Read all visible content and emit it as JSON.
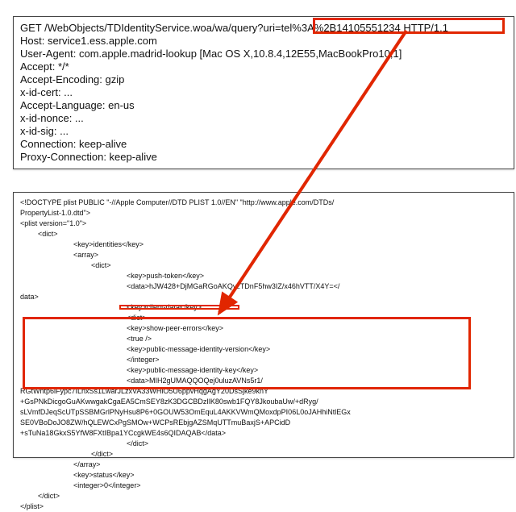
{
  "http": {
    "method_line": "GET /WebObjects/TDIdentityService.woa/wa/query?uri=tel%3A%2B14105551234 HTTP/1.1",
    "host": "Host: service1.ess.apple.com",
    "ua": "User-Agent: com.apple.madrid-lookup [Mac OS X,10.8.4,12E55,MacBookPro10,1]",
    "accept": "Accept: */*",
    "enc": "Accept-Encoding: gzip",
    "cert": "x-id-cert: ...",
    "lang": "Accept-Language: en-us",
    "nonce": "x-id-nonce: ...",
    "sig": "x-id-sig: ...",
    "conn": "Connection: keep-alive",
    "proxy": "Proxy-Connection: keep-alive"
  },
  "plist": {
    "doctype1": "<!DOCTYPE plist PUBLIC \"-//Apple Computer//DTD PLIST 1.0//EN\" \"http://www.apple.com/DTDs/",
    "doctype2": "PropertyList-1.0.dtd\">",
    "plist_open": "<plist version=\"1.0\">",
    "dict_open": "<dict>",
    "key_identities": "<key>identities</key>",
    "array_open": "<array>",
    "dict2_open": "<dict>",
    "key_push": "<key>push-token</key>",
    "data_push1": "<data>hJW428+DjMGaRGoAKQvzTDnF5hw3IZ/x46hVTT/X4Y=</",
    "data_push2": "data>",
    "key_client": "<key>client-data</key>",
    "dict3_open": "<dict>",
    "key_show": "<key>show-peer-errors</key>",
    "true": "<true />",
    "key_pmiv": "<key>public-message-identity-version</key>",
    "wbr1": "</integer>",
    "key_pmik": "<key>public-message-identity-key</key>",
    "data_pub1": "<data>MIH2gUMAQQOQej0uluzAVNs5r1/",
    "data_pub2": "RGtWntp6iFypc7ILnxSs1LwarJLzxVA33WHiO5U6ppvHqgAgY20DsSjke9knY",
    "data_pub3": "+GsPNkDicgoGuAKwwgakCgaEA5CmSEY8zK3DGCBDzIlK80swb1FQY8JkoubaUw/+dRyg/",
    "data_pub4": "sLVmfDJeqScUTpSSBMGrlPNyHsu8P6+0GOUW53OmEquL4AKKVWmQMoxdpPI06L0oJAHhiNtlEGx",
    "data_pub5": "SE0VBoDoJO8ZW/hQLEWCxPgSMOw+WCPsREbjgAZSMqUTTmuBaxjS+APCidD",
    "data_pub6": "+sTuNa18GkxS5YfW8FXtIBpa1YCcgkWE4s6QIDAQAB</data>",
    "dict3_close": "</dict>",
    "dict2_close": "</dict>",
    "array_close": "</array>",
    "key_status": "<key>status</key>",
    "int_status": "<integer>0</integer>",
    "dict_close": "</dict>",
    "plist_close": "</plist>"
  }
}
